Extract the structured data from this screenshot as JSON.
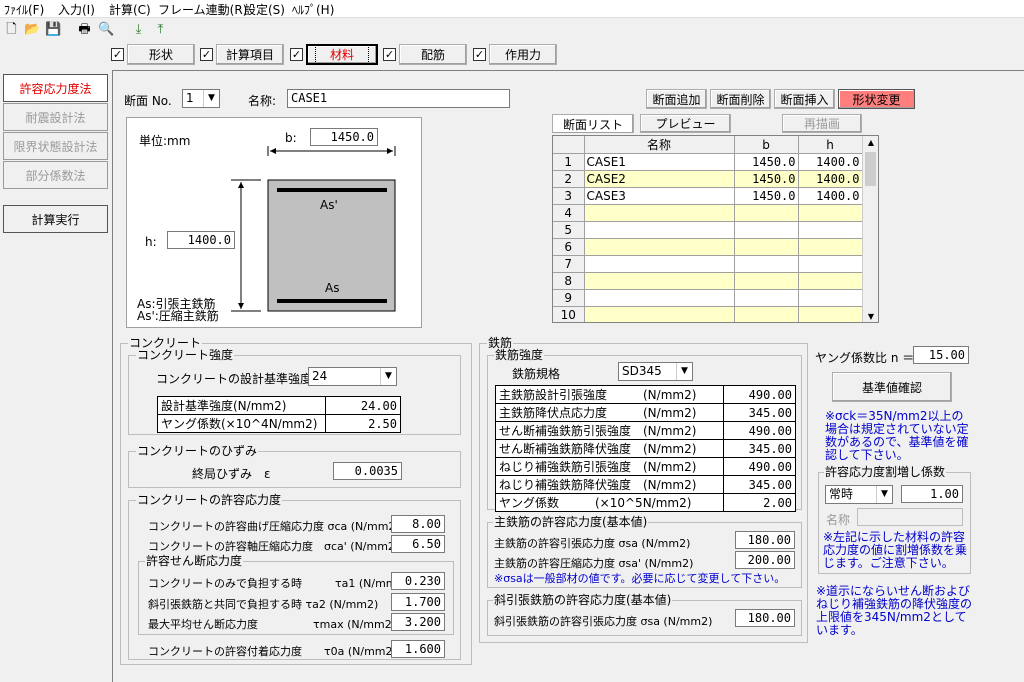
{
  "menu": [
    "ﾌｧｲﾙ(F)",
    "入力(I)",
    "計算(C)",
    "フレーム連動(R)",
    "設定(S)",
    "ﾍﾙﾌﾟ(H)"
  ],
  "tabs": [
    {
      "label": "形状",
      "checked": true
    },
    {
      "label": "計算項目",
      "checked": true
    },
    {
      "label": "材料",
      "checked": true,
      "active": true
    },
    {
      "label": "配筋",
      "checked": true
    },
    {
      "label": "作用力",
      "checked": true
    }
  ],
  "sidebar": {
    "methods": [
      {
        "label": "許容応力度法",
        "active": true
      },
      {
        "label": "耐震設計法",
        "active": false
      },
      {
        "label": "限界状態設計法",
        "active": false
      },
      {
        "label": "部分係数法",
        "active": false
      }
    ],
    "run_label": "計算実行"
  },
  "section": {
    "no_label": "断面 No.",
    "no_value": "1",
    "name_label": "名称:",
    "name_value": "CASE1",
    "buttons": {
      "add": "断面追加",
      "delete": "断面削除",
      "insert": "断面挿入",
      "shape_change": "形状変更"
    }
  },
  "diagram": {
    "unit": "単位:mm",
    "b_label": "b:",
    "b_value": "1450.0",
    "h_label": "h:",
    "h_value": "1400.0",
    "as_prime": "As'",
    "as": "As",
    "legend1": "As:引張主鉄筋",
    "legend2": "As':圧縮主鉄筋"
  },
  "list": {
    "tab_list": "断面リスト",
    "tab_preview": "プレビュー",
    "redraw": "再描画",
    "headers": [
      "名称",
      "b",
      "h"
    ],
    "rows": [
      {
        "no": "1",
        "name": "CASE1",
        "b": "1450.0",
        "h": "1400.0"
      },
      {
        "no": "2",
        "name": "CASE2",
        "b": "1450.0",
        "h": "1400.0"
      },
      {
        "no": "3",
        "name": "CASE3",
        "b": "1450.0",
        "h": "1400.0"
      },
      {
        "no": "4",
        "name": "",
        "b": "",
        "h": ""
      },
      {
        "no": "5",
        "name": "",
        "b": "",
        "h": ""
      },
      {
        "no": "6",
        "name": "",
        "b": "",
        "h": ""
      },
      {
        "no": "7",
        "name": "",
        "b": "",
        "h": ""
      },
      {
        "no": "8",
        "name": "",
        "b": "",
        "h": ""
      },
      {
        "no": "9",
        "name": "",
        "b": "",
        "h": ""
      },
      {
        "no": "10",
        "name": "",
        "b": "",
        "h": ""
      }
    ]
  },
  "concrete": {
    "title": "コンクリート",
    "strength_title": "コンクリート強度",
    "design_strength_label": "コンクリートの設計基準強度",
    "design_strength_value": "24",
    "props": [
      {
        "label": "設計基準強度(N/mm2)",
        "value": "24.00"
      },
      {
        "label": "ヤング係数(×10^4N/mm2)",
        "value": "2.50"
      }
    ],
    "strain_title": "コンクリートのひずみ",
    "strain_label": "終局ひずみ　ε",
    "strain_value": "0.0035",
    "allow_title": "コンクリートの許容応力度",
    "bend_label": "コンクリートの許容曲げ圧縮応力度 σca (N/mm2)",
    "bend_value": "8.00",
    "axial_label": "コンクリートの許容軸圧縮応力度　σca' (N/mm2)",
    "axial_value": "6.50",
    "shear_title": "許容せん断応力度",
    "shear": [
      {
        "label": "コンクリートのみで負担する時　　　τa1 (N/mm2)",
        "value": "0.230"
      },
      {
        "label": "斜引張鉄筋と共同で負担する時 τa2 (N/mm2)",
        "value": "1.700"
      },
      {
        "label": "最大平均せん断応力度　　　　　τmax (N/mm2)",
        "value": "3.200"
      }
    ],
    "bond_label": "コンクリートの許容付着応力度　　τ0a (N/mm2)",
    "bond_value": "1.600"
  },
  "rebar": {
    "title": "鉄筋",
    "strength_title": "鉄筋強度",
    "grade_label": "鉄筋規格",
    "grade_value": "SD345",
    "props": [
      {
        "label": "主鉄筋設計引張強度　　　(N/mm2)",
        "value": "490.00"
      },
      {
        "label": "主鉄筋降伏点応力度　　　(N/mm2)",
        "value": "345.00"
      },
      {
        "label": "せん断補強鉄筋引張強度　(N/mm2)",
        "value": "490.00"
      },
      {
        "label": "せん断補強鉄筋降伏強度　(N/mm2)",
        "value": "345.00"
      },
      {
        "label": "ねじり補強鉄筋引張強度　(N/mm2)",
        "value": "490.00"
      },
      {
        "label": "ねじり補強鉄筋降伏強度　(N/mm2)",
        "value": "345.00"
      },
      {
        "label": "ヤング係数　　　(×10^5N/mm2)",
        "value": "2.00"
      }
    ],
    "main_allow_title": "主鉄筋の許容応力度(基本値)",
    "tension_label": "主鉄筋の許容引張応力度 σsa (N/mm2)",
    "tension_value": "180.00",
    "compress_label": "主鉄筋の許容圧縮応力度 σsa' (N/mm2)",
    "compress_value": "200.00",
    "main_note": "※σsaは一般部材の値です。必要に応じて変更して下さい。",
    "diag_title": "斜引張鉄筋の許容応力度(基本値)",
    "diag_label": "斜引張鉄筋の許容引張応力度 σsa (N/mm2)",
    "diag_value": "180.00"
  },
  "young": {
    "label": "ヤング係数比 n ＝",
    "value": "15.00",
    "check_button": "基準値確認",
    "note": "※σck＝35N/mm2以上の場合は規定されていない定数があるので、基準値を確認して下さい。"
  },
  "increase": {
    "title": "許容応力度割増し係数",
    "case_value": "常時",
    "factor_value": "1.00",
    "name_label": "名称",
    "name_value": "",
    "note": "※左記に示した材料の許容応力度の値に割増係数を乗じます。ご注意下さい。"
  },
  "bottom_note": "※道示にならいせん断およびねじり補強鉄筋の降伏強度の上限値を345N/mm2としています。"
}
